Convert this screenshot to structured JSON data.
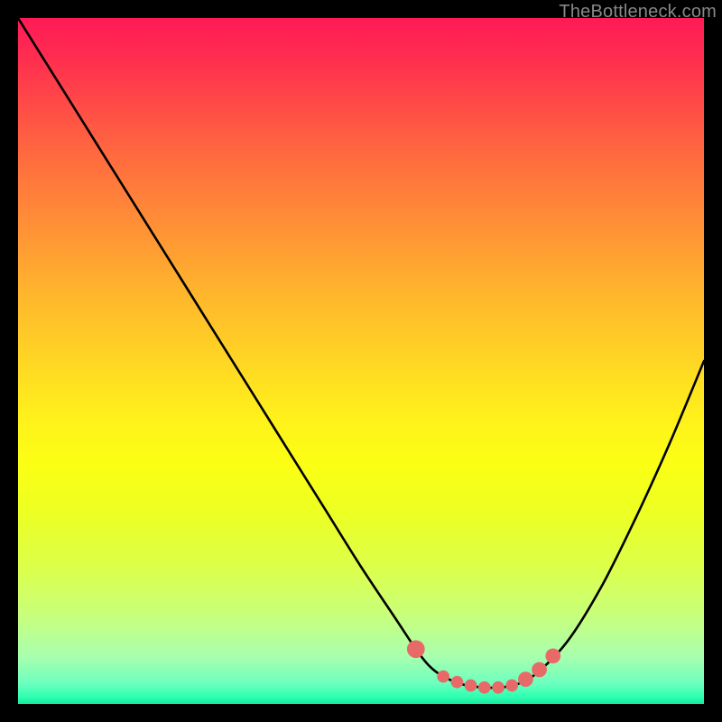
{
  "watermark": "TheBottleneck.com",
  "colors": {
    "page_bg": "#000000",
    "gradient_top": "#ff1a57",
    "gradient_mid": "#fff01b",
    "gradient_bottom": "#14e89e",
    "curve_stroke": "#000000",
    "marker_fill": "#e86a68",
    "watermark": "#888888"
  },
  "chart_data": {
    "type": "line",
    "title": "",
    "xlabel": "",
    "ylabel": "",
    "xlim": [
      0,
      100
    ],
    "ylim": [
      0,
      100
    ],
    "grid": false,
    "legend": false,
    "series": [
      {
        "name": "bottleneck-curve",
        "x": [
          0,
          5,
          10,
          15,
          20,
          25,
          30,
          35,
          40,
          45,
          50,
          55,
          58,
          60,
          62,
          65,
          68,
          70,
          72,
          75,
          80,
          85,
          90,
          95,
          100
        ],
        "y": [
          100,
          92,
          84,
          76,
          68,
          60,
          52,
          44,
          36,
          28,
          20,
          12.5,
          8,
          5.5,
          4,
          2.8,
          2.4,
          2.4,
          2.7,
          4,
          9,
          17,
          27,
          38,
          50
        ]
      }
    ],
    "markers": [
      {
        "name": "near-bottom-dot",
        "x": 58,
        "y": 8.0,
        "r": 1.3
      },
      {
        "name": "flat-region-start",
        "x": 62,
        "y": 4.0,
        "r": 0.9
      },
      {
        "name": "flat-region-a",
        "x": 64,
        "y": 3.2,
        "r": 0.9
      },
      {
        "name": "flat-region-b",
        "x": 66,
        "y": 2.7,
        "r": 0.9
      },
      {
        "name": "flat-region-c",
        "x": 68,
        "y": 2.4,
        "r": 0.9
      },
      {
        "name": "flat-region-d",
        "x": 70,
        "y": 2.4,
        "r": 0.9
      },
      {
        "name": "flat-region-e",
        "x": 72,
        "y": 2.7,
        "r": 0.9
      },
      {
        "name": "right-slope-a",
        "x": 74,
        "y": 3.6,
        "r": 1.1
      },
      {
        "name": "right-slope-b",
        "x": 76,
        "y": 5.0,
        "r": 1.1
      },
      {
        "name": "right-slope-c",
        "x": 78,
        "y": 7.0,
        "r": 1.1
      }
    ]
  }
}
